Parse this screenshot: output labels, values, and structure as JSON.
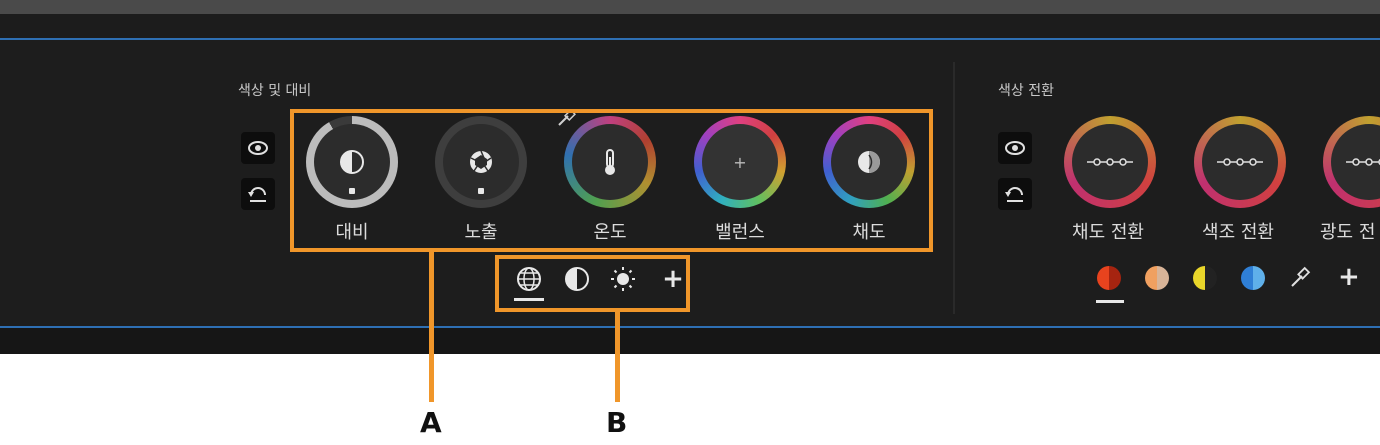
{
  "left_section": {
    "title": "색상 및 대비",
    "side_buttons": [
      "eye-icon",
      "undo-icon"
    ],
    "dials": [
      {
        "label": "대비",
        "icon": "contrast-icon"
      },
      {
        "label": "노출",
        "icon": "aperture-icon"
      },
      {
        "label": "온도",
        "icon": "thermometer-icon"
      },
      {
        "label": "밸런스",
        "icon": "plus",
        "center_text": "+"
      },
      {
        "label": "채도",
        "icon": "saturation-icon"
      }
    ],
    "mode_tabs": [
      {
        "icon": "globe-icon",
        "active": true
      },
      {
        "icon": "contrast-half-icon",
        "active": false
      },
      {
        "icon": "sun-icon",
        "active": false
      },
      {
        "icon": "plus-icon",
        "text": "+",
        "active": false
      }
    ]
  },
  "right_section": {
    "title": "색상 전환",
    "side_buttons": [
      "eye-icon",
      "undo-icon"
    ],
    "dials": [
      {
        "label": "채도 전환"
      },
      {
        "label": "색조 전환"
      },
      {
        "label": "광도 전"
      }
    ],
    "swatches": [
      {
        "left": "#e8431e",
        "right": "#a62410",
        "active": true
      },
      {
        "left": "#f0a060",
        "right": "#d8b498",
        "active": false
      },
      {
        "left": "#e9d62a",
        "right": "#222222",
        "active": false
      },
      {
        "left": "#2f7fd6",
        "right": "#5fb0ea",
        "active": false
      }
    ],
    "extra_icons": [
      "eyedropper-icon",
      "plus-icon"
    ],
    "plus_text": "+"
  },
  "annotations": {
    "a_label": "A",
    "b_label": "B",
    "color": "#f0962a"
  }
}
